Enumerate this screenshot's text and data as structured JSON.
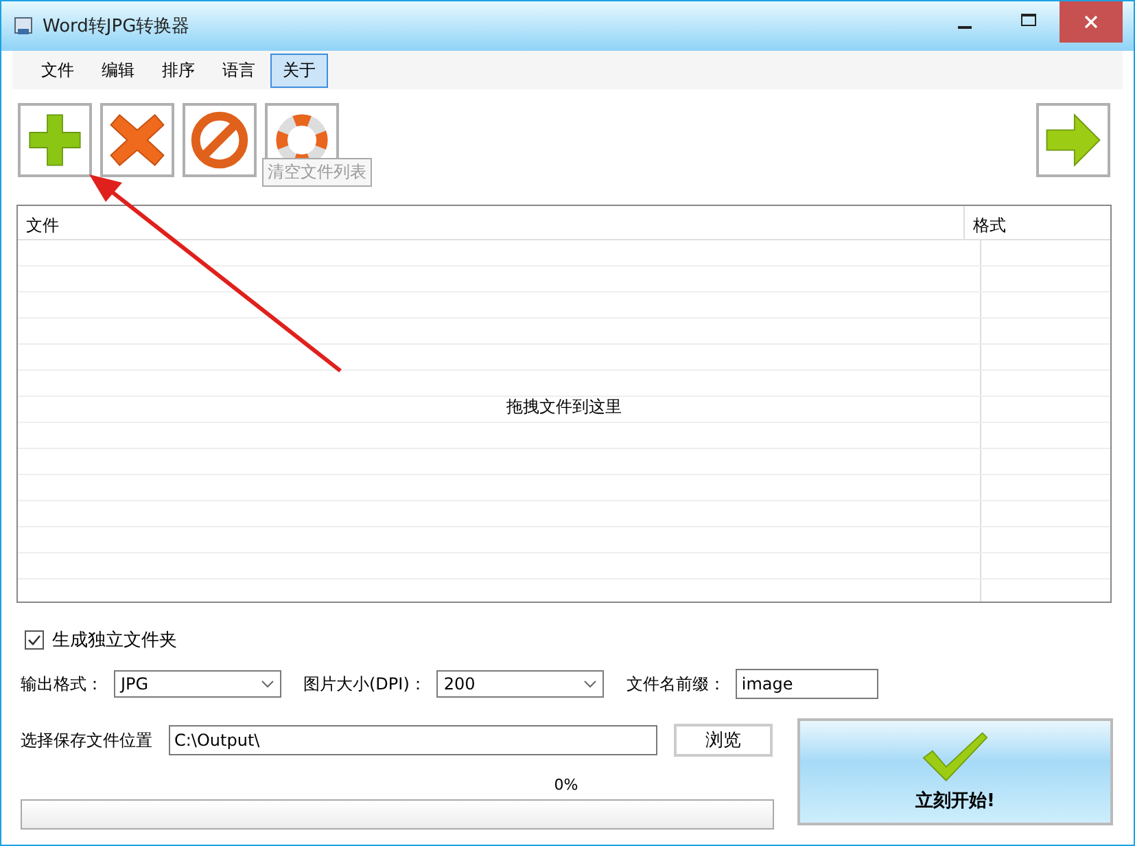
{
  "window": {
    "title": "Word转JPG转换器"
  },
  "menu": [
    {
      "label": "文件",
      "selected": false
    },
    {
      "label": "编辑",
      "selected": false
    },
    {
      "label": "排序",
      "selected": false
    },
    {
      "label": "语言",
      "selected": false
    },
    {
      "label": "关于",
      "selected": true
    }
  ],
  "toolbar": [
    {
      "kind": "add"
    },
    {
      "kind": "remove"
    },
    {
      "kind": "stop"
    },
    {
      "kind": "clear",
      "tooltip": "清空文件列表"
    }
  ],
  "table": {
    "columns": [
      "文件",
      "格式"
    ],
    "empty_message": "拖拽文件到这里"
  },
  "options": {
    "separate_folder": {
      "label": "生成独立文件夹",
      "checked": true
    },
    "output_format": {
      "label": "输出格式：",
      "value": "JPG"
    },
    "dpi": {
      "label": "图片大小(DPI)：",
      "value": "200"
    },
    "prefix": {
      "label": "文件名前缀：",
      "value": "image"
    },
    "save_location": {
      "label": "选择保存文件位置",
      "value": "C:\\Output\\"
    },
    "browse_button": "浏览"
  },
  "progress": {
    "reading": "0%",
    "level": 0
  },
  "start_button": "立刻开始!"
}
